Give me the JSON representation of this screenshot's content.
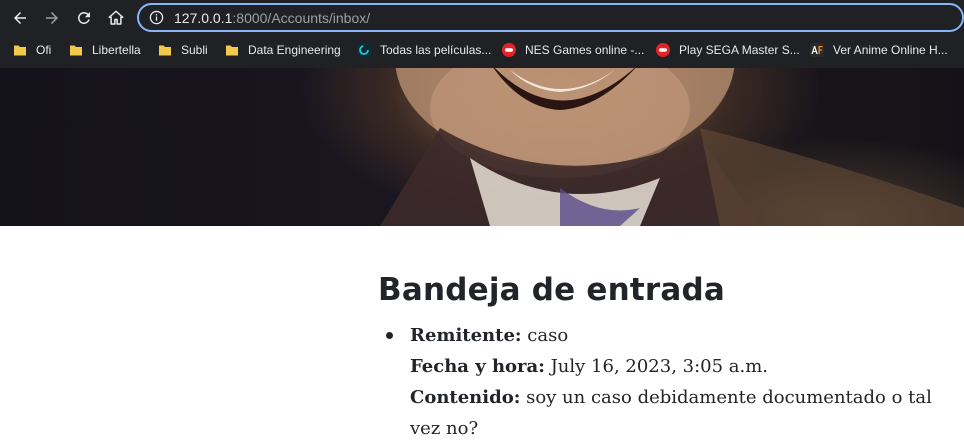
{
  "browser": {
    "url_host": "127.0.0.1",
    "url_rest": ":8000/Accounts/inbox/",
    "bookmarks": [
      {
        "label": "Ofi",
        "icon": "folder-icon"
      },
      {
        "label": "Libertella",
        "icon": "folder-icon"
      },
      {
        "label": "Subli",
        "icon": "folder-icon"
      },
      {
        "label": "Data Engineering",
        "icon": "folder-icon"
      },
      {
        "label": "Todas las películas...",
        "icon": "site-favicon"
      },
      {
        "label": "NES Games online -...",
        "icon": "gamepad-icon"
      },
      {
        "label": "Play SEGA Master S...",
        "icon": "gamepad-icon"
      },
      {
        "label": "Ver Anime Online H...",
        "icon": "af-logo-icon"
      }
    ]
  },
  "page": {
    "title": "Bandeja de entrada",
    "messages": [
      {
        "sender_label": "Remitente:",
        "sender": "caso",
        "datetime_label": "Fecha y hora:",
        "datetime": "July 16, 2023, 3:05 a.m.",
        "content_label": "Contenido:",
        "content": "soy un caso debidamente documentado o tal vez no?"
      }
    ]
  }
}
